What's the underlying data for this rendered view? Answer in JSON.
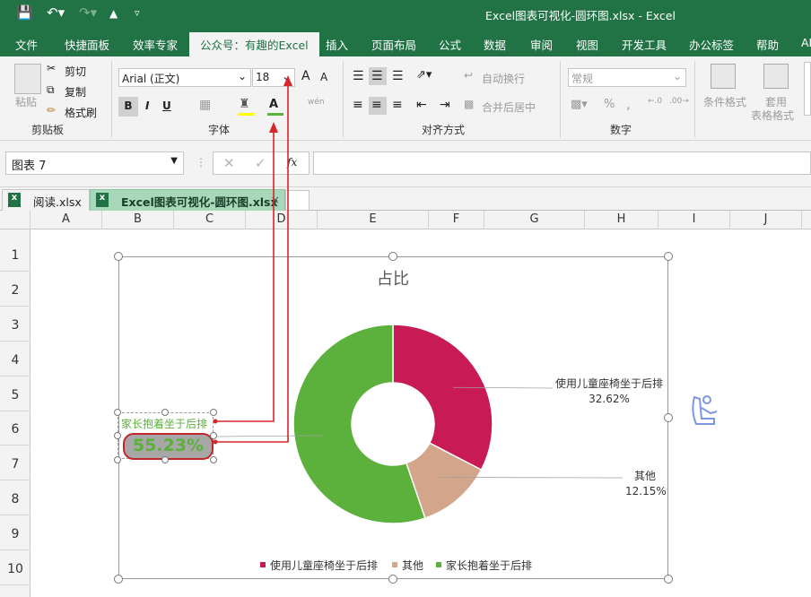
{
  "title_bar": {
    "title": "Excel图表可视化-圆环图.xlsx  -  Excel"
  },
  "ribbon_tabs": [
    "文件",
    "快捷面板",
    "效率专家",
    "公众号：有趣的Excel",
    "插入",
    "页面布局",
    "公式",
    "数据",
    "审阅",
    "视图",
    "开发工具",
    "办公标签",
    "帮助",
    "AI"
  ],
  "clipboard": {
    "paste": "粘贴",
    "cut": "剪切",
    "copy": "复制",
    "format_painter": "格式刷",
    "group": "剪贴板"
  },
  "font": {
    "name": "Arial (正文)",
    "size": "18",
    "bold": "B",
    "italic": "I",
    "underline": "U",
    "increase": "A",
    "decrease": "A",
    "group": "字体"
  },
  "alignment": {
    "wrap": "自动换行",
    "merge": "合并后居中",
    "group": "对齐方式"
  },
  "number": {
    "format": "常规",
    "percent": "%",
    "comma": ",",
    "group": "数字"
  },
  "styles": {
    "conditional": "条件格式",
    "table1": "套用",
    "table2": "表格格式"
  },
  "formula": {
    "name_box": "图表 7",
    "fx": "fx",
    "value": ""
  },
  "book_tabs": [
    {
      "label": "阅读.xlsx"
    },
    {
      "label": "Excel图表可视化-圆环图.xlsx *",
      "close": "×"
    }
  ],
  "columns": [
    "A",
    "B",
    "C",
    "D",
    "E",
    "F",
    "G",
    "H",
    "I",
    "J"
  ],
  "rows": [
    "1",
    "2",
    "3",
    "4",
    "5",
    "6",
    "7",
    "8",
    "9",
    "10"
  ],
  "accent_green": "#217346",
  "chart_data": {
    "type": "pie",
    "title": "占比",
    "series": [
      {
        "name": "使用儿童座椅坐于后排",
        "value": 32.62,
        "label": "32.62%",
        "color": "#c81a55"
      },
      {
        "name": "其他",
        "value": 12.15,
        "label": "12.15%",
        "color": "#d3a68b"
      },
      {
        "name": "家长抱着坐于后排",
        "value": 55.23,
        "label": "55.23%",
        "color": "#5bb13c"
      }
    ],
    "legend": "bottom"
  }
}
